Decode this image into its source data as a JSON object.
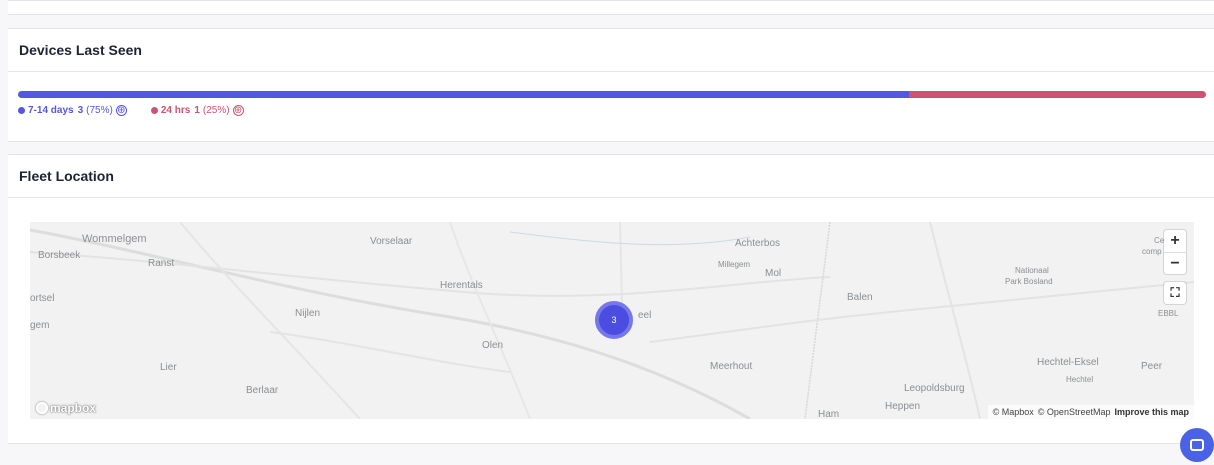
{
  "devices_last_seen": {
    "title": "Devices Last Seen",
    "segments": [
      {
        "label": "7-14 days",
        "count": "3",
        "percent": "(75%)",
        "fraction": 0.75,
        "color": "#5457e0"
      },
      {
        "label": "24 hrs",
        "count": "1",
        "percent": "(25%)",
        "fraction": 0.25,
        "color": "#cc5472"
      }
    ],
    "add_glyph": "⊕"
  },
  "fleet_location": {
    "title": "Fleet Location",
    "cluster_count": "3",
    "places": [
      "Wommelgem",
      "Borsbeek",
      "Ranst",
      "Vorselaar",
      "Achterbos",
      "Millegem",
      "Mol",
      "Herentals",
      "Nationaal",
      "Park Bosland",
      "Balen",
      "Nijlen",
      "ortsel",
      "gem",
      "Olen",
      "eel",
      "Meerhout",
      "Lier",
      "Berlaar",
      "Hechtel-Eksel",
      "Hechtel",
      "Peer",
      "Leopoldsburg",
      "Heppen",
      "Ham",
      "EBBL",
      "Ce",
      "comp"
    ],
    "zoom_in": "+",
    "zoom_out": "−",
    "fullscreen": "⛶",
    "logo": "mapbox",
    "attribution": [
      "© Mapbox",
      "© OpenStreetMap"
    ],
    "improve": "Improve this map"
  }
}
